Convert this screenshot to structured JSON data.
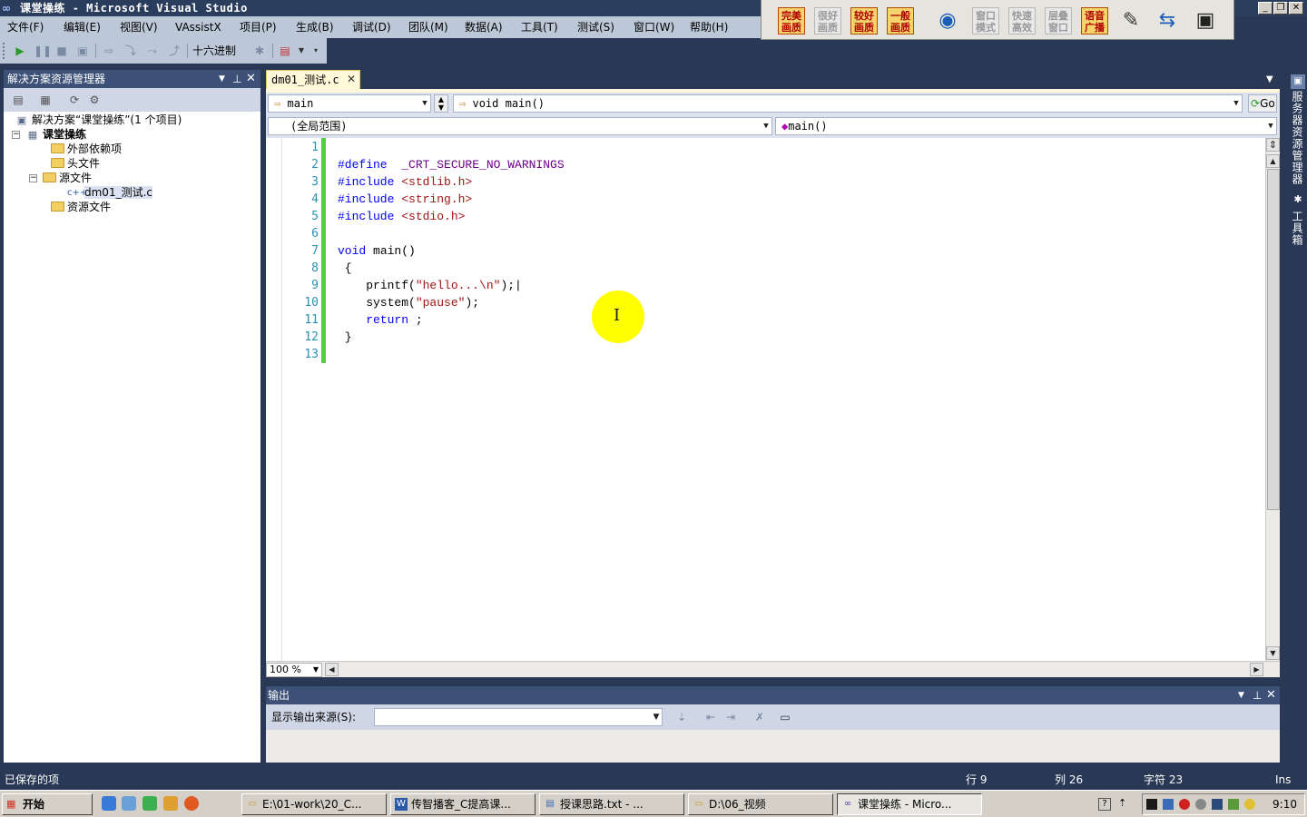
{
  "window": {
    "title": "课堂操练 - Microsoft Visual Studio",
    "minimize": "_",
    "restore": "❐",
    "close": "✕"
  },
  "quality_toolbar": {
    "buttons": [
      "完美画质",
      "很好画质",
      "较好画质",
      "一般画质",
      "窗口模式",
      "快速高效",
      "层叠窗口",
      "语音广播"
    ]
  },
  "menu": [
    "文件(F)",
    "编辑(E)",
    "视图(V)",
    "VAssistX",
    "项目(P)",
    "生成(B)",
    "调试(D)",
    "团队(M)",
    "数据(A)",
    "工具(T)",
    "测试(S)",
    "窗口(W)",
    "帮助(H)"
  ],
  "toolbar": {
    "hex_label": "十六进制"
  },
  "solution_explorer": {
    "title": "解决方案资源管理器",
    "solution": "解决方案“课堂操练”(1 个项目)",
    "project": "课堂操练",
    "items": {
      "external": "外部依赖项",
      "headers": "头文件",
      "sources": "源文件",
      "file": "dm01_测试.c",
      "resources": "资源文件"
    }
  },
  "editor": {
    "tab": "dm01_测试.c",
    "nav_left": "main",
    "nav_right": "void main()",
    "go_label": "Go",
    "scope_left": "(全局范围)",
    "scope_right": "main()",
    "zoom": "100 %",
    "line_numbers": [
      "1",
      "2",
      "3",
      "4",
      "5",
      "6",
      "7",
      "8",
      "9",
      "10",
      "11",
      "12",
      "13"
    ],
    "code": {
      "l2_a": "#define",
      "l2_b": "  _CRT_SECURE_NO_WARNINGS",
      "l3_a": "#include",
      "l3_b": " <stdlib.h>",
      "l4_a": "#include",
      "l4_b": " <string.h>",
      "l5_a": "#include",
      "l5_b": " <stdio.h>",
      "l7_a": "void",
      "l7_b": " main()",
      "l8": " {",
      "l9_a": "    printf(",
      "l9_b": "\"hello...\\n\"",
      "l9_c": ");|",
      "l10_a": "    system(",
      "l10_b": "\"pause\"",
      "l10_c": ");",
      "l11_a": "    return",
      "l11_b": " ;",
      "l12": " }"
    }
  },
  "output": {
    "title": "输出",
    "source_label": "显示输出来源(S):"
  },
  "right_strip": {
    "server_explorer": "服务器资源管理器",
    "toolbox": "工具箱"
  },
  "status": {
    "message": "已保存的项",
    "row": "行 9",
    "col": "列 26",
    "char": "字符 23",
    "mode": "Ins"
  },
  "taskbar": {
    "start": "开始",
    "tasks": [
      "E:\\01-work\\20_C...",
      "传智播客_C提高课...",
      "授课思路.txt - ...",
      "D:\\06_视频",
      "课堂操练 - Micro..."
    ],
    "clock": "9:10"
  },
  "colors": {
    "accent": "#293955",
    "change_bar": "#5cc84a",
    "keyword": "#0000ff",
    "string": "#a31515",
    "macro": "#6f008a"
  }
}
